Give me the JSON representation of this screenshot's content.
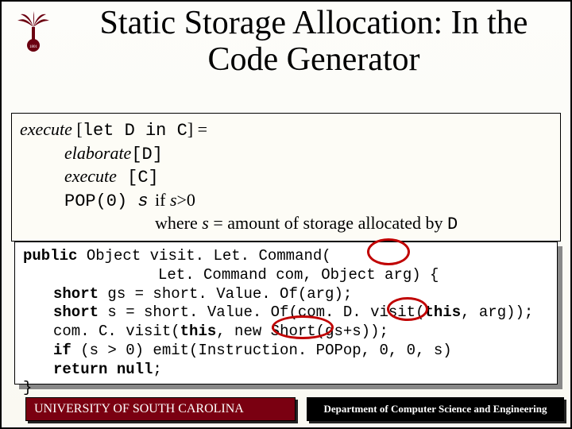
{
  "title": "Static Storage Allocation: In the Code Generator",
  "rule": {
    "line1_exec": "execute",
    "line1_rest1": " [",
    "line1_let": "let ",
    "line1_D": "D",
    "line1_in": " in ",
    "line1_C": "C",
    "line1_rest2": "] =",
    "line2_elab": "elaborate",
    "line2_D": "[D]",
    "line3_exec": "execute",
    "line3_C": " [C]",
    "line4_pop": "POP(0) ",
    "line4_s": "s",
    "line4_if": "if ",
    "line4_s2": "s",
    "line4_gt": ">0",
    "line5_where": "where ",
    "line5_s": "s",
    "line5_eq": " = amount of storage allocated by ",
    "line5_D": "D"
  },
  "code": {
    "l1a": "public",
    "l1b": " Object visit. Let. Command(",
    "l2": "Let. Command com, Object arg) {",
    "l3a": "short",
    "l3b": " gs = short. Value. Of(arg);",
    "l4a": "short",
    "l4b": " s = short. Value. Of(com. D. visit(",
    "l4c": "this",
    "l4d": ", arg));",
    "l5a": "com. C. visit(",
    "l5b": "this",
    "l5c": ", new Short(gs+s));",
    "l6a": "if",
    "l6b": " (s > 0) emit(Instruction. POPop, 0, 0, s)",
    "l7a": "return null",
    "l7b": ";",
    "l8": "}"
  },
  "footer": {
    "left": "UNIVERSITY OF SOUTH CAROLINA",
    "right": "Department of Computer Science and Engineering"
  }
}
